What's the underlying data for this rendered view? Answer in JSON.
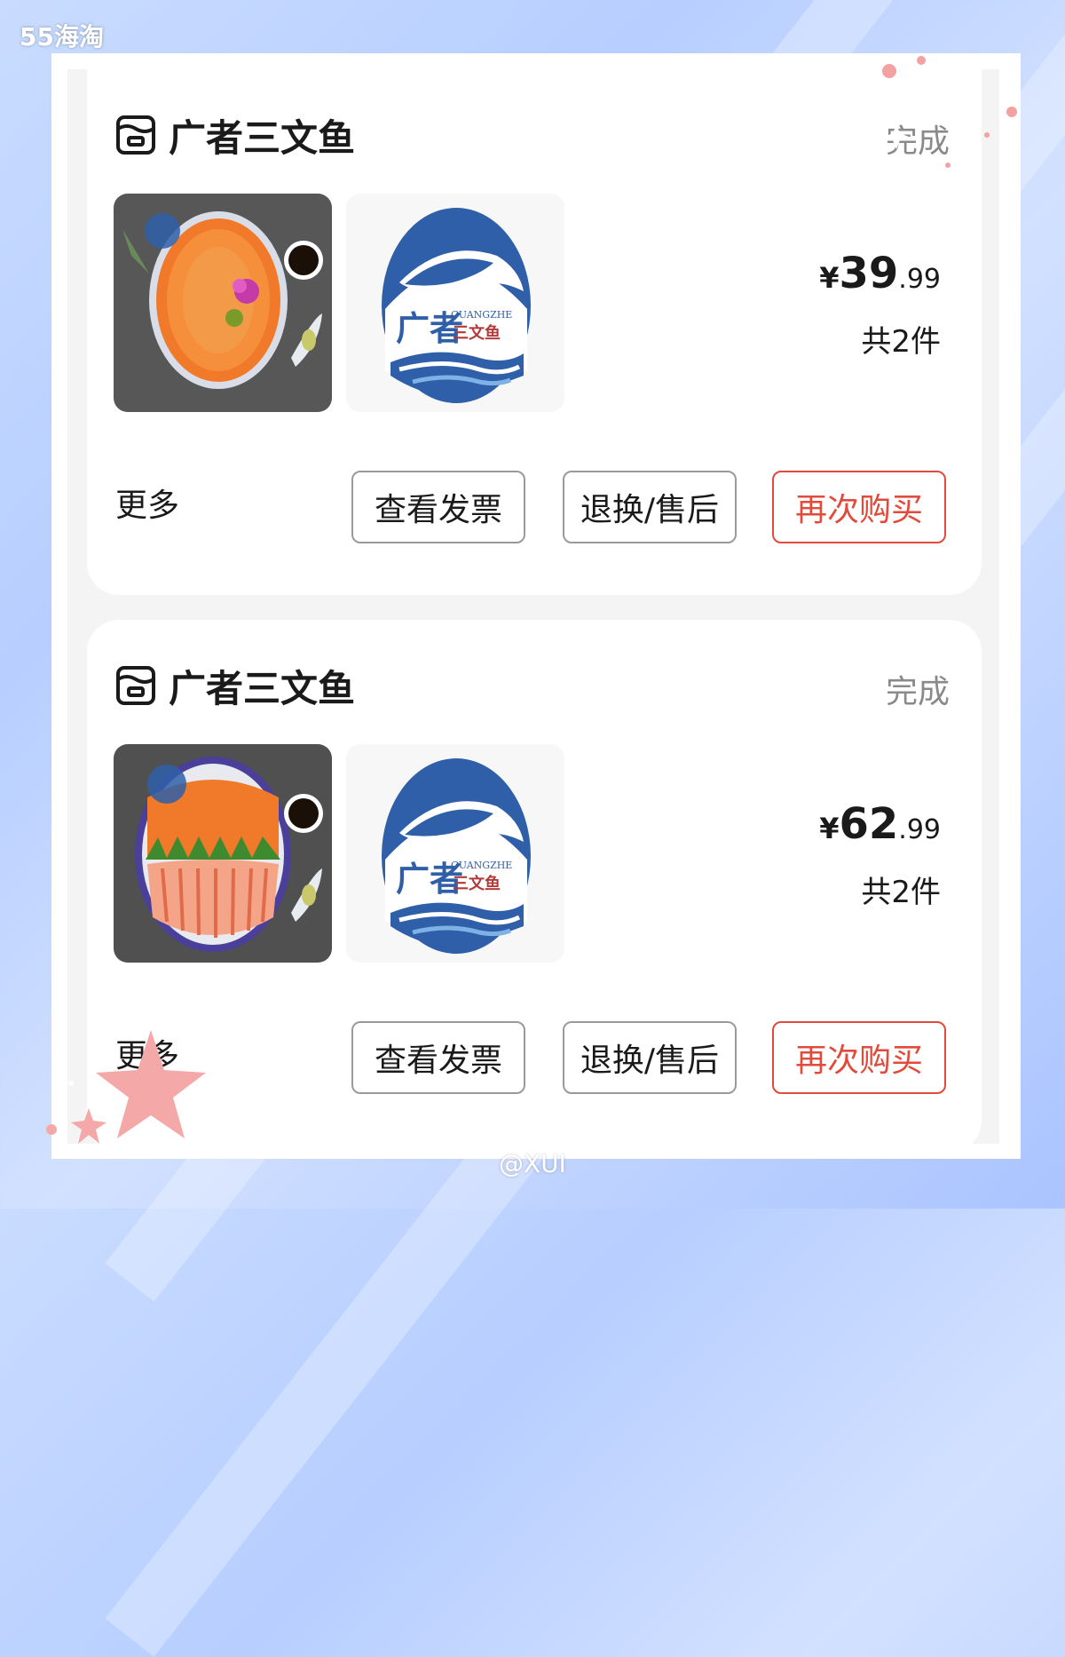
{
  "watermark": {
    "top": "55海淘",
    "bottom": "@XUI"
  },
  "orders": [
    {
      "shop_name": "广者三文鱼",
      "status": "完成",
      "price_symbol": "¥",
      "price_int": "39",
      "price_dec": ".99",
      "quantity": "共2件",
      "more": "更多",
      "buttons": {
        "invoice": "查看发票",
        "refund": "退换/售后",
        "rebuy": "再次购买"
      }
    },
    {
      "shop_name": "广者三文鱼",
      "status": "完成",
      "price_symbol": "¥",
      "price_int": "62",
      "price_dec": ".99",
      "quantity": "共2件",
      "more": "更多",
      "buttons": {
        "invoice": "查看发票",
        "refund": "退换/售后",
        "rebuy": "再次购买"
      }
    }
  ],
  "logo_text": {
    "brand_en": "GUANGZHE",
    "brand_cn": "广者",
    "tag": "三文鱼"
  },
  "colors": {
    "accent_red": "#e24a3b",
    "logo_blue": "#2f5fa8",
    "background": "#bcd2ff"
  }
}
